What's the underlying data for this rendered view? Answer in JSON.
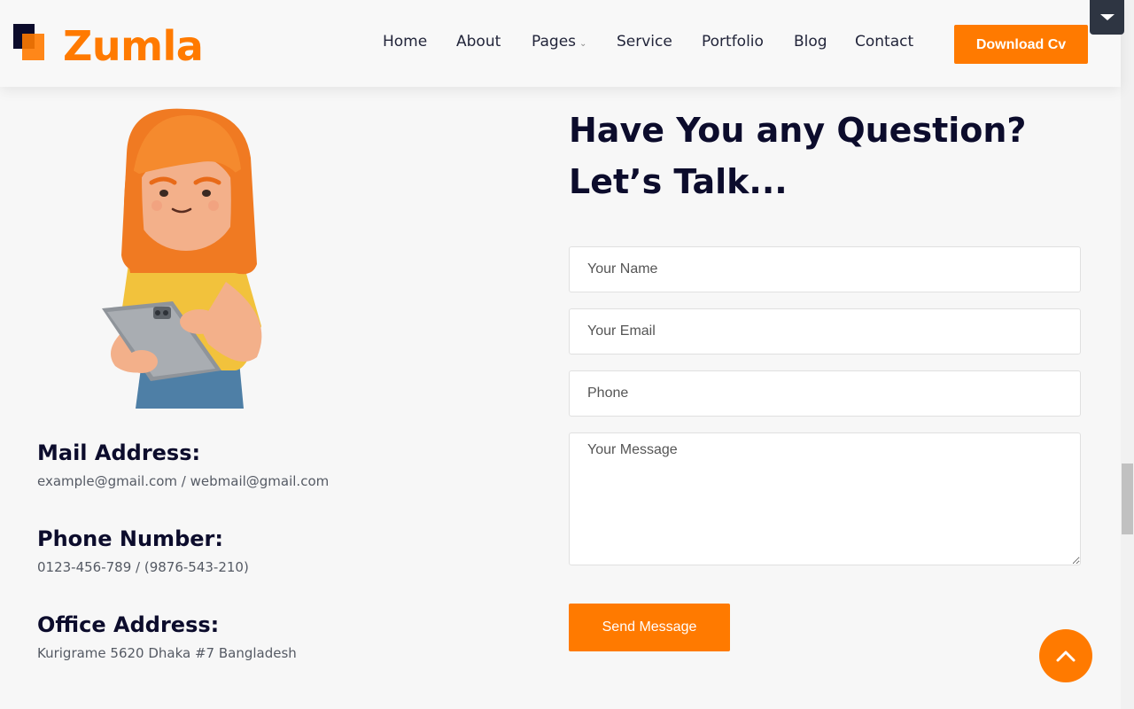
{
  "brand": {
    "name": "Zumla",
    "accent": "#ff7a00",
    "dark": "#0c0c2c"
  },
  "nav": {
    "items": [
      {
        "label": "Home"
      },
      {
        "label": "About"
      },
      {
        "label": "Pages",
        "has_dropdown": true
      },
      {
        "label": "Service"
      },
      {
        "label": "Portfolio"
      },
      {
        "label": "Blog"
      },
      {
        "label": "Contact"
      }
    ],
    "cta": "Download Cv"
  },
  "contact_info": {
    "mail": {
      "heading": "Mail Address:",
      "value": "example@gmail.com / webmail@gmail.com"
    },
    "phone": {
      "heading": "Phone Number:",
      "value": "0123-456-789 / (9876-543-210)"
    },
    "office": {
      "heading": "Office Address:",
      "value": "Kurigrame 5620 Dhaka #7 Bangladesh"
    }
  },
  "form": {
    "title_line1": "Have You any Question?",
    "title_line2": "Let’s Talk...",
    "name_placeholder": "Your Name",
    "email_placeholder": "Your Email",
    "phone_placeholder": "Phone",
    "message_placeholder": "Your Message",
    "submit_label": "Send Message"
  },
  "icons": {
    "corner_toggle": "caret-down-icon",
    "back_to_top": "chevron-up-icon"
  }
}
